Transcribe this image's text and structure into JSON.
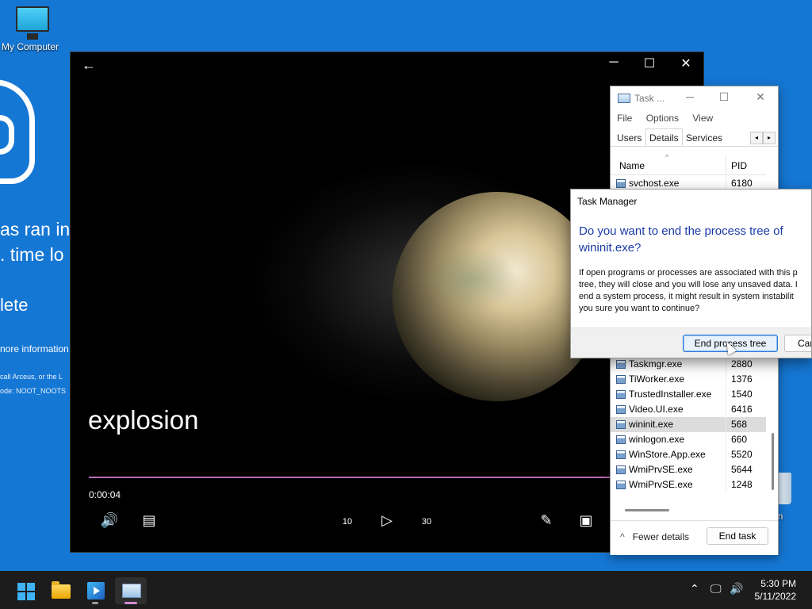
{
  "desktop": {
    "my_computer_label": "My Computer",
    "recycle_bin_label": "Bin",
    "bsod": {
      "line1": "as ran in",
      "line2": ". time lo",
      "line3": "lete",
      "line4": "nore information",
      "line5": "call Arceus, or the L",
      "line6": "ode: NOOT_NOOTS"
    }
  },
  "player": {
    "back_glyph": "←",
    "minimize_glyph": "─",
    "maximize_glyph": "☐",
    "close_glyph": "✕",
    "caption": "explosion",
    "current_time": "0:00:04",
    "progress_fraction": 0.006,
    "accent_color": "#b86ab8",
    "controls": {
      "volume_glyph": "🔊",
      "subtitles_glyph": "▤",
      "rewind_label": "10",
      "play_glyph": "▷",
      "forward_label": "30",
      "edit_glyph": "✎",
      "miniview_glyph": "▣"
    }
  },
  "task_manager": {
    "title": "Task ...",
    "minimize_glyph": "─",
    "maximize_glyph": "☐",
    "close_glyph": "✕",
    "menu": [
      "File",
      "Options",
      "View"
    ],
    "tabs": [
      "Users",
      "Details",
      "Services"
    ],
    "active_tab": "Details",
    "tab_left_glyph": "◂",
    "tab_right_glyph": "▸",
    "sort_glyph": "^",
    "columns": {
      "name": "Name",
      "pid": "PID"
    },
    "rows": [
      {
        "name": "svchost.exe",
        "pid": "6180"
      },
      {
        "name": "Taskmgr.exe",
        "pid": "2880"
      },
      {
        "name": "TiWorker.exe",
        "pid": "1376"
      },
      {
        "name": "TrustedInstaller.exe",
        "pid": "1540"
      },
      {
        "name": "Video.UI.exe",
        "pid": "6416"
      },
      {
        "name": "wininit.exe",
        "pid": "568"
      },
      {
        "name": "winlogon.exe",
        "pid": "660"
      },
      {
        "name": "WinStore.App.exe",
        "pid": "5520"
      },
      {
        "name": "WmiPrvSE.exe",
        "pid": "5644"
      },
      {
        "name": "WmiPrvSE.exe",
        "pid": "1248"
      }
    ],
    "selected_process": "wininit.exe",
    "fewer_details_glyph": "^",
    "fewer_details_label": "Fewer details",
    "end_task_label": "End task"
  },
  "dialog": {
    "title": "Task Manager",
    "question": "Do you want to end the process tree of wininit.exe?",
    "message_lines": [
      "If open programs or processes are associated with this p",
      "tree, they will close and you will lose any unsaved data. I",
      "end a system process, it might result in system instabilit",
      "you sure you want to continue?"
    ],
    "confirm_label": "End process tree",
    "cancel_label": "Car"
  },
  "taskbar": {
    "tray_chevron_glyph": "⌃",
    "network_glyph": "🖵",
    "volume_glyph": "🔊",
    "time": "5:30 PM",
    "date": "5/11/2022"
  }
}
